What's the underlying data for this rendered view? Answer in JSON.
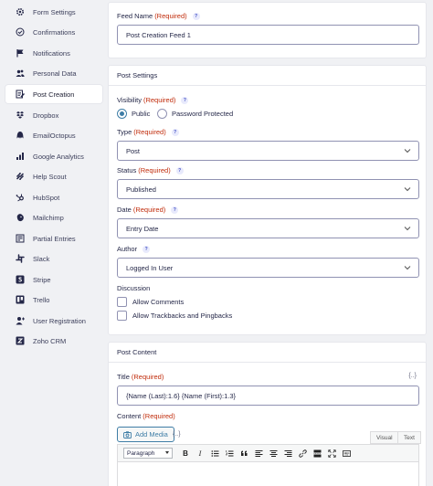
{
  "sidebar": {
    "items": [
      {
        "label": "Form Settings",
        "icon": "gear-icon"
      },
      {
        "label": "Confirmations",
        "icon": "check-circle-icon"
      },
      {
        "label": "Notifications",
        "icon": "flag-icon"
      },
      {
        "label": "Personal Data",
        "icon": "users-icon"
      },
      {
        "label": "Post Creation",
        "icon": "post-icon",
        "active": true
      },
      {
        "label": "Dropbox",
        "icon": "dropbox-icon"
      },
      {
        "label": "EmailOctopus",
        "icon": "octopus-icon"
      },
      {
        "label": "Google Analytics",
        "icon": "analytics-icon"
      },
      {
        "label": "Help Scout",
        "icon": "helpscout-icon"
      },
      {
        "label": "HubSpot",
        "icon": "hubspot-icon"
      },
      {
        "label": "Mailchimp",
        "icon": "mailchimp-icon"
      },
      {
        "label": "Partial Entries",
        "icon": "partial-entries-icon"
      },
      {
        "label": "Slack",
        "icon": "slack-icon"
      },
      {
        "label": "Stripe",
        "icon": "stripe-icon"
      },
      {
        "label": "Trello",
        "icon": "trello-icon"
      },
      {
        "label": "User Registration",
        "icon": "user-registration-icon"
      },
      {
        "label": "Zoho CRM",
        "icon": "zoho-icon"
      }
    ]
  },
  "feed": {
    "label": "Feed Name",
    "required": "(Required)",
    "help": "?",
    "value": "Post Creation Feed 1"
  },
  "post_settings": {
    "title": "Post Settings",
    "visibility": {
      "label": "Visibility",
      "required": "(Required)",
      "options": [
        "Public",
        "Password Protected"
      ],
      "selected": "Public"
    },
    "type": {
      "label": "Type",
      "required": "(Required)",
      "value": "Post"
    },
    "status": {
      "label": "Status",
      "required": "(Required)",
      "value": "Published"
    },
    "date": {
      "label": "Date",
      "required": "(Required)",
      "value": "Entry Date"
    },
    "author": {
      "label": "Author",
      "value": "Logged In User"
    },
    "discussion": {
      "label": "Discussion",
      "options": [
        "Allow Comments",
        "Allow Trackbacks and Pingbacks"
      ]
    }
  },
  "post_content": {
    "title": "Post Content",
    "title_field": {
      "label": "Title",
      "required": "(Required)",
      "value": "{Name (Last):1.6} {Name (First):1.3}",
      "merge_tag": "{..}"
    },
    "content_field": {
      "label": "Content",
      "required": "(Required)",
      "merge_tag": "{..}",
      "add_media": "Add Media",
      "tabs": [
        "Visual",
        "Text"
      ],
      "format": "Paragraph"
    }
  },
  "colors": {
    "required": "#c02b0a",
    "accent": "#3e7da6",
    "help_bg": "#e8eafc",
    "help_fg": "#4855c6"
  }
}
